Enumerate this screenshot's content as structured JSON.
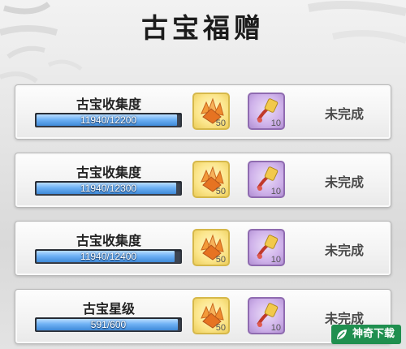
{
  "title": "古宝福赠",
  "cards": [
    {
      "name": "古宝收集度",
      "progress_text": "11940/12200",
      "progress": 0.979,
      "reward1_qty": "50",
      "reward2_qty": "10",
      "status": "未完成"
    },
    {
      "name": "古宝收集度",
      "progress_text": "11940/12300",
      "progress": 0.971,
      "reward1_qty": "50",
      "reward2_qty": "10",
      "status": "未完成"
    },
    {
      "name": "古宝收集度",
      "progress_text": "11940/12400",
      "progress": 0.963,
      "reward1_qty": "50",
      "reward2_qty": "10",
      "status": "未完成"
    },
    {
      "name": "古宝星级",
      "progress_text": "591/600",
      "progress": 0.985,
      "reward1_qty": "50",
      "reward2_qty": "10",
      "status": "未完成"
    }
  ],
  "watermark": "神奇下载",
  "icons": {
    "reward1": "orange-crystal-icon",
    "reward2": "purple-lantern-icon",
    "watermark": "leaf-logo-icon"
  },
  "colors": {
    "bar_fill": "#5aa2ea",
    "gold_frame": "#d6b84a",
    "purple_frame": "#8f6bb0",
    "watermark_bg": "#1f8f4f"
  }
}
